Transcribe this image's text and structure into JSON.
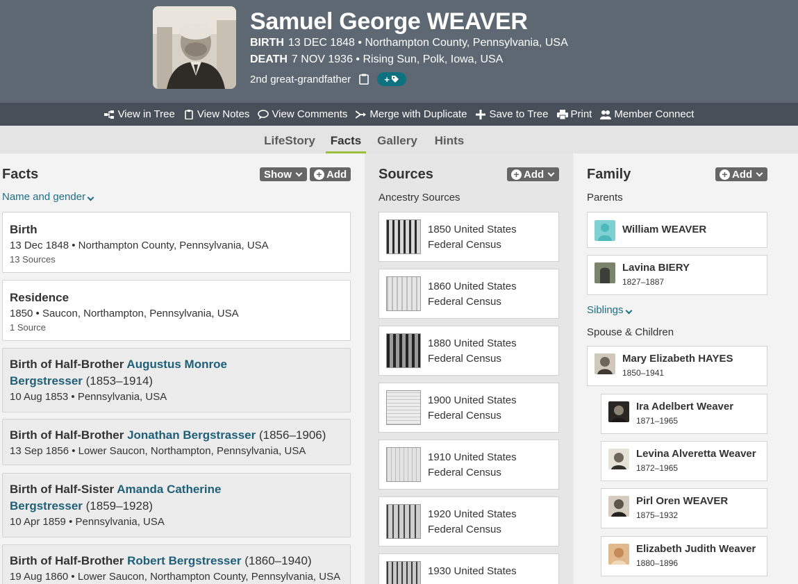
{
  "person": {
    "name": "Samuel George WEAVER",
    "birth_label": "BIRTH",
    "birth_value": "13 DEC 1848 • Northampton County, Pennsylvania, USA",
    "death_label": "DEATH",
    "death_value": "7 NOV 1936 • Rising Sun, Polk, Iowa, USA",
    "relationship": "2nd great-grandfather",
    "tag_label": "+"
  },
  "toolbar": {
    "view_in_tree": "View in Tree",
    "view_notes": "View Notes",
    "view_comments": "View Comments",
    "merge": "Merge with Duplicate",
    "save_to_tree": "Save to Tree",
    "print": "Print",
    "member_connect": "Member Connect"
  },
  "tabs": [
    "LifeStory",
    "Facts",
    "Gallery",
    "Hints"
  ],
  "facts": {
    "title": "Facts",
    "show_label": "Show",
    "add_label": "Add",
    "name_gender": "Name and gender",
    "items": [
      {
        "title": "Birth",
        "sub": "13 Dec 1848 • Northampton County, Pennsylvania, USA",
        "src": "13 Sources"
      },
      {
        "title": "Residence",
        "sub": "1850 • Saucon, Northampton, Pennsylvania, USA",
        "src": "1 Source"
      },
      {
        "prefix": "Birth of Half-Brother",
        "link1": "Augustus Monroe",
        "link2": "Bergstresser",
        "years": "(1853–1914)",
        "sub": "10 Aug 1853 • Pennsylvania, USA"
      },
      {
        "prefix": "Birth of Half-Brother",
        "link1": "Jonathan Bergstrasser",
        "years": "(1856–1906)",
        "sub": "13 Sep 1856 • Lower Saucon, Northampton, Pennsylvania, USA"
      },
      {
        "prefix": "Birth of Half-Sister",
        "link1": "Amanda Catherine",
        "link2": "Bergstresser",
        "years": "(1859–1928)",
        "sub": "10 Apr 1859 • Pennsylvania, USA"
      },
      {
        "prefix": "Birth of Half-Brother",
        "link1": "Robert Bergstresser",
        "years": "(1860–1940)",
        "sub": "19 Aug 1860 • Lower Saucon, Northampton County, Pennsylvania, USA"
      }
    ]
  },
  "sources": {
    "title": "Sources",
    "add_label": "Add",
    "group_label": "Ancestry Sources",
    "items": [
      {
        "line1": "1850 United States",
        "line2": "Federal Census"
      },
      {
        "line1": "1860 United States",
        "line2": "Federal Census"
      },
      {
        "line1": "1880 United States",
        "line2": "Federal Census"
      },
      {
        "line1": "1900 United States",
        "line2": "Federal Census"
      },
      {
        "line1": "1910 United States",
        "line2": "Federal Census"
      },
      {
        "line1": "1920 United States",
        "line2": "Federal Census"
      },
      {
        "line1": "1930 United States",
        "line2": ""
      }
    ]
  },
  "family": {
    "title": "Family",
    "add_label": "Add",
    "parents_label": "Parents",
    "siblings_label": "Siblings",
    "spouse_label": "Spouse & Children",
    "parents": [
      {
        "name": "William WEAVER",
        "years": ""
      },
      {
        "name": "Lavina BIERY",
        "years": "1827–1887"
      }
    ],
    "spouse": {
      "name": "Mary Elizabeth HAYES",
      "years": "1850–1941"
    },
    "children": [
      {
        "name": "Ira Adelbert Weaver",
        "years": "1871–1965"
      },
      {
        "name": "Levina Alveretta Weaver",
        "years": "1872–1965"
      },
      {
        "name": "Pirl Oren WEAVER",
        "years": "1875–1932"
      },
      {
        "name": "Elizabeth Judith Weaver",
        "years": "1880–1896"
      }
    ]
  }
}
